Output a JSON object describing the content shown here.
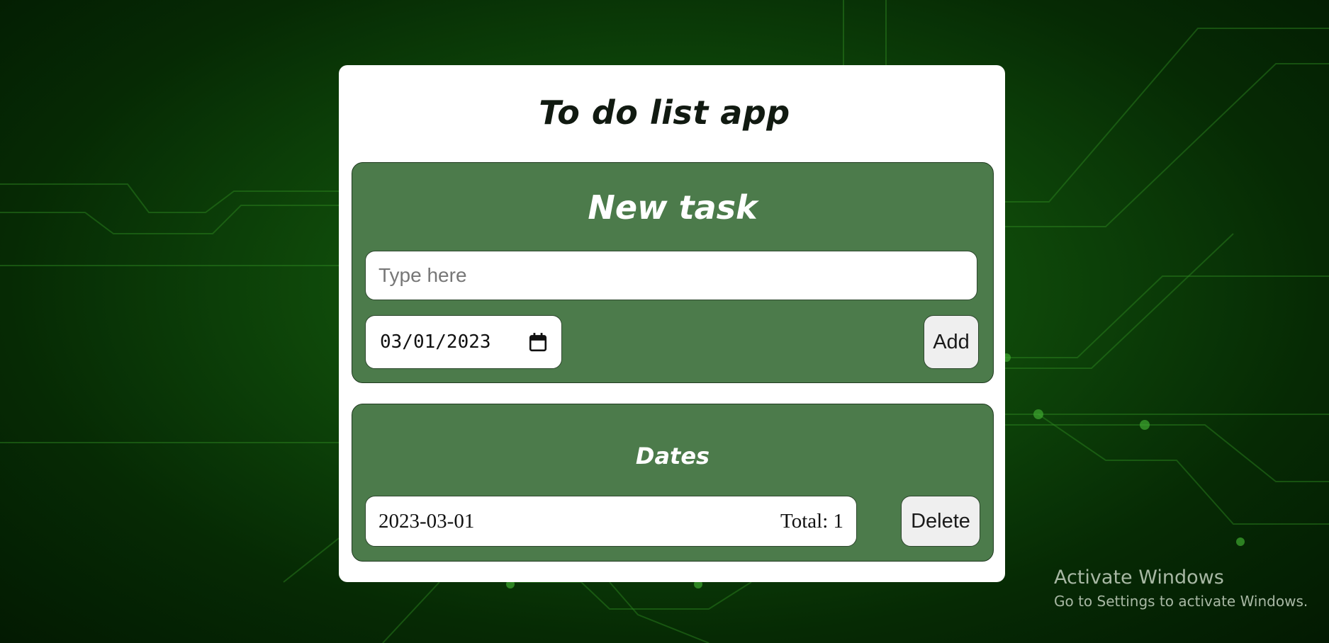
{
  "app": {
    "title": "To do list app"
  },
  "new_task": {
    "heading": "New task",
    "input_placeholder": "Type here",
    "input_value": "",
    "date_value": "03/01/2023",
    "add_label": "Add"
  },
  "dates": {
    "heading": "Dates",
    "rows": [
      {
        "date": "2023-03-01",
        "total": "Total: 1",
        "delete_label": "Delete"
      }
    ]
  },
  "watermark": {
    "title": "Activate Windows",
    "subtitle": "Go to Settings to activate Windows."
  },
  "colors": {
    "panel": "#4c7b4b",
    "card": "#ffffff",
    "background": "#0f4a0a"
  },
  "icons": {
    "date_picker": "calendar-icon"
  }
}
